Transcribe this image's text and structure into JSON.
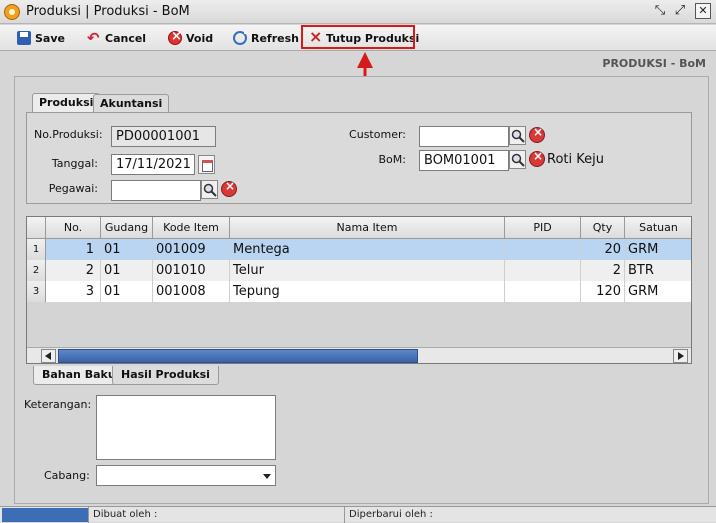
{
  "window": {
    "title": "Produksi | Produksi - BoM",
    "controls": [
      "restore-icon",
      "maximize-icon",
      "close-icon"
    ]
  },
  "toolbar": {
    "save_label": "Save",
    "cancel_label": "Cancel",
    "void_label": "Void",
    "refresh_label": "Refresh",
    "close_production_label": "Tutup Produksi",
    "highlight_color": "#d61a1a"
  },
  "page_label": "PRODUKSI - BoM",
  "tabs": {
    "produksi": "Produksi",
    "akuntansi": "Akuntansi"
  },
  "form": {
    "no_produksi_label": "No.Produksi:",
    "no_produksi_value": "PD00001001",
    "tanggal_label": "Tanggal:",
    "tanggal_value": "17/11/2021",
    "pegawai_label": "Pegawai:",
    "pegawai_value": "",
    "customer_label": "Customer:",
    "customer_value": "",
    "bom_label": "BoM:",
    "bom_value": "BOM01001",
    "bom_name": "Roti Keju"
  },
  "grid": {
    "columns": [
      "No.",
      "Gudang",
      "Kode Item",
      "Nama Item",
      "PID",
      "Qty",
      "Satuan"
    ],
    "rows": [
      {
        "row_num": "1",
        "no": "1",
        "gudang": "01",
        "kode": "001009",
        "nama": "Mentega",
        "pid": "",
        "qty": "20",
        "satuan": "GRM"
      },
      {
        "row_num": "2",
        "no": "2",
        "gudang": "01",
        "kode": "001010",
        "nama": "Telur",
        "pid": "",
        "qty": "2",
        "satuan": "BTR"
      },
      {
        "row_num": "3",
        "no": "3",
        "gudang": "01",
        "kode": "001008",
        "nama": "Tepung",
        "pid": "",
        "qty": "120",
        "satuan": "GRM"
      }
    ],
    "selected_row_color": "#b9d5f2"
  },
  "bottom_tabs": {
    "bahan_baku": "Bahan Baku",
    "hasil_produksi": "Hasil Produksi"
  },
  "keterangan_label": "Keterangan:",
  "cabang_label": "Cabang:",
  "cabang_value": "",
  "status": {
    "dibuat_oleh": "Dibuat oleh :",
    "diperbarui_oleh": "Diperbarui oleh :"
  }
}
